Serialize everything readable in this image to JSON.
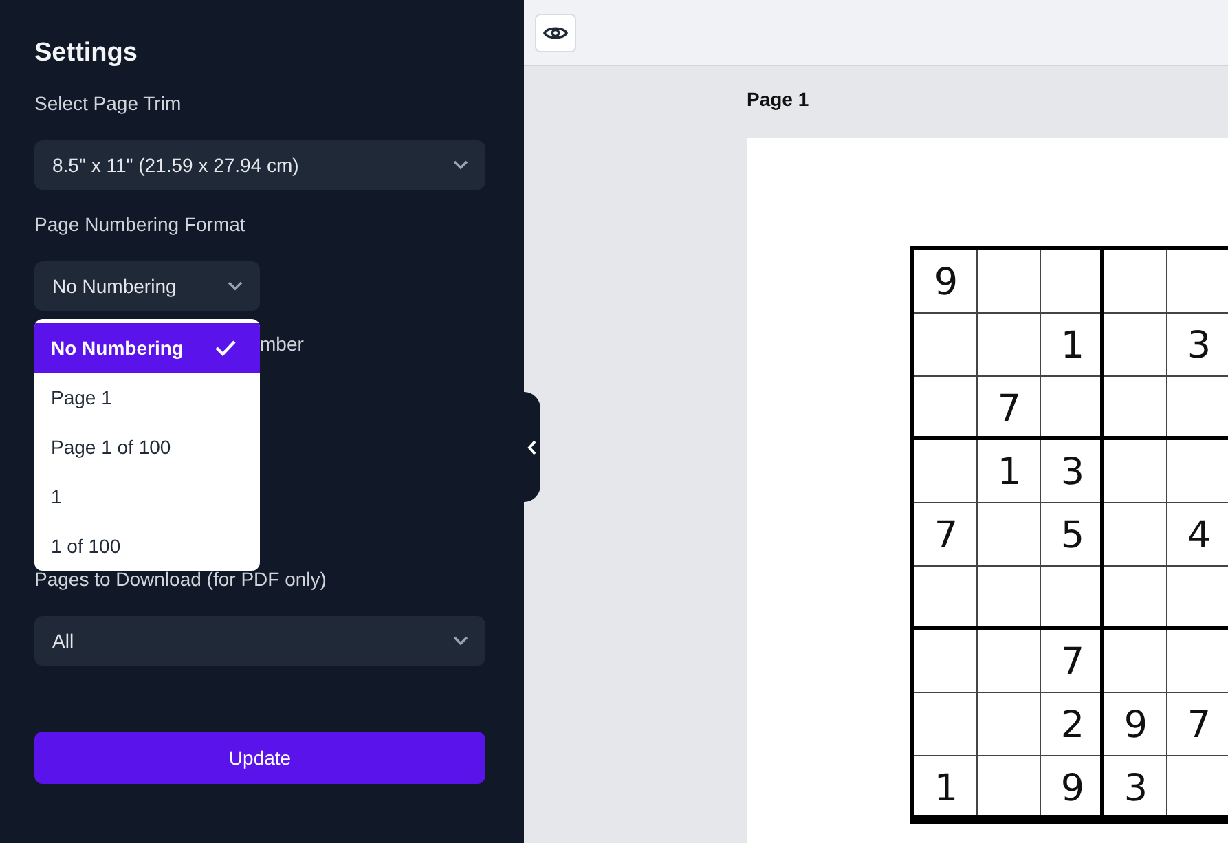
{
  "sidebar": {
    "title": "Settings",
    "page_trim": {
      "label": "Select Page Trim",
      "value": "8.5\" x 11\" (21.59 x 27.94 cm)"
    },
    "page_numbering": {
      "label": "Page Numbering Format",
      "value": "No Numbering",
      "expanded": true,
      "options": [
        {
          "label": "No Numbering",
          "selected": true
        },
        {
          "label": "Page 1",
          "selected": false
        },
        {
          "label": "Page 1 of 100",
          "selected": false
        },
        {
          "label": "1",
          "selected": false
        },
        {
          "label": "1 of 100",
          "selected": false
        }
      ]
    },
    "partially_hidden_label": "mber",
    "pages_to_download": {
      "label": "Pages to Download (for PDF only)",
      "value": "All"
    },
    "update_button": "Update"
  },
  "preview": {
    "page_title": "Page 1",
    "grid_rows": [
      [
        "9",
        null,
        null,
        null,
        null
      ],
      [
        null,
        null,
        "1",
        null,
        "3"
      ],
      [
        null,
        "7",
        null,
        null,
        null
      ],
      [
        null,
        "1",
        "3",
        null,
        null
      ],
      [
        "7",
        null,
        "5",
        null,
        "4"
      ],
      [
        null,
        null,
        null,
        null,
        null
      ],
      [
        null,
        null,
        "7",
        null,
        null
      ],
      [
        null,
        null,
        "2",
        "9",
        "7"
      ],
      [
        "1",
        null,
        "9",
        "3",
        null
      ]
    ]
  }
}
